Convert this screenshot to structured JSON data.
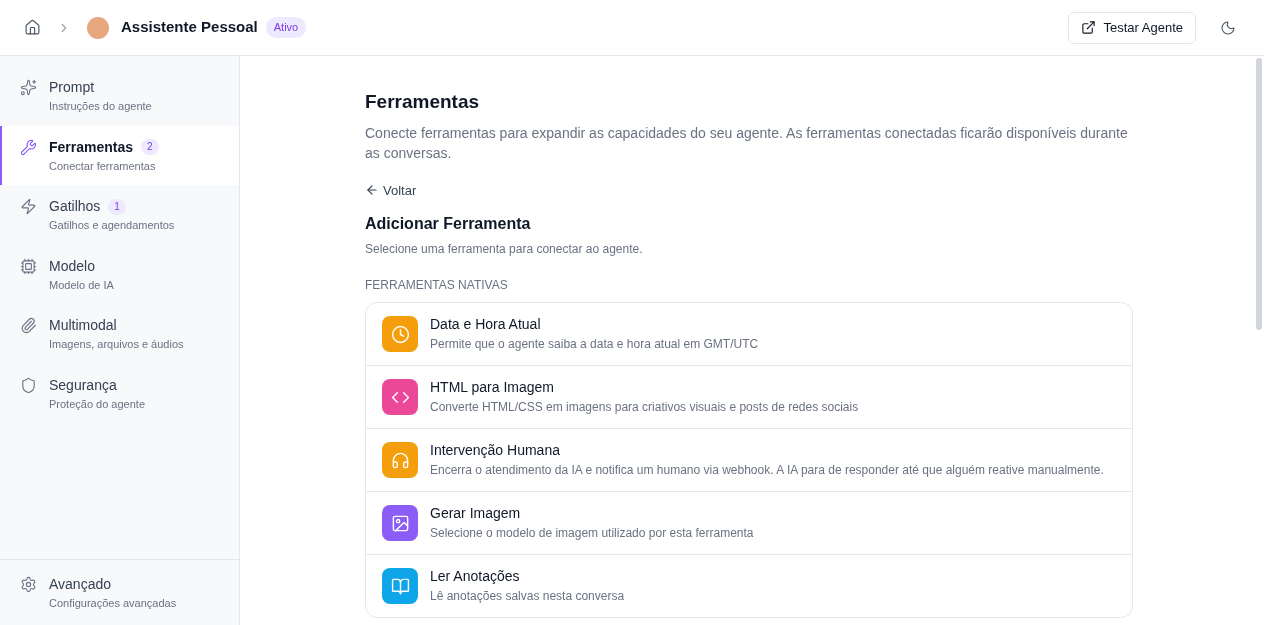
{
  "header": {
    "agent_name": "Assistente Pessoal",
    "status": "Ativo",
    "test_button": "Testar Agente"
  },
  "sidebar": {
    "items": [
      {
        "kind": "prompt",
        "label": "Prompt",
        "sublabel": "Instruções do agente",
        "selected": false
      },
      {
        "kind": "tools",
        "label": "Ferramentas",
        "sublabel": "Conectar ferramentas",
        "badge": "2",
        "selected": true
      },
      {
        "kind": "triggers",
        "label": "Gatilhos",
        "sublabel": "Gatilhos e agendamentos",
        "badge": "1",
        "selected": false
      },
      {
        "kind": "model",
        "label": "Modelo",
        "sublabel": "Modelo de IA",
        "selected": false
      },
      {
        "kind": "multimodal",
        "label": "Multimodal",
        "sublabel": "Imagens, arquivos e áudios",
        "selected": false
      },
      {
        "kind": "security",
        "label": "Segurança",
        "sublabel": "Proteção do agente",
        "selected": false
      }
    ],
    "footer": {
      "kind": "advanced",
      "label": "Avançado",
      "sublabel": "Configurações avançadas",
      "selected": false
    }
  },
  "main": {
    "title": "Ferramentas",
    "description": "Conecte ferramentas para expandir as capacidades do seu agente. As ferramentas conectadas ficarão disponíveis durante as conversas.",
    "back": "Voltar",
    "section_title": "Adicionar Ferramenta",
    "section_description": "Selecione uma ferramenta para conectar ao agente.",
    "group_label": "FERRAMENTAS NATIVAS",
    "tools": [
      {
        "kind": "clock",
        "color": "#f59e0b",
        "name": "Data e Hora Atual",
        "description": "Permite que o agente saiba a data e hora atual em GMT/UTC"
      },
      {
        "kind": "code",
        "color": "#ec4899",
        "name": "HTML para Imagem",
        "description": "Converte HTML/CSS em imagens para criativos visuais e posts de redes sociais"
      },
      {
        "kind": "headset",
        "color": "#f59e0b",
        "name": "Intervenção Humana",
        "description": "Encerra o atendimento da IA e notifica um humano via webhook. A IA para de responder até que alguém reative manualmente."
      },
      {
        "kind": "image",
        "color": "#8b5cf6",
        "name": "Gerar Imagem",
        "description": "Selecione o modelo de imagem utilizado por esta ferramenta"
      },
      {
        "kind": "book",
        "color": "#0ea5e9",
        "name": "Ler Anotações",
        "description": "Lê anotações salvas nesta conversa"
      }
    ]
  }
}
